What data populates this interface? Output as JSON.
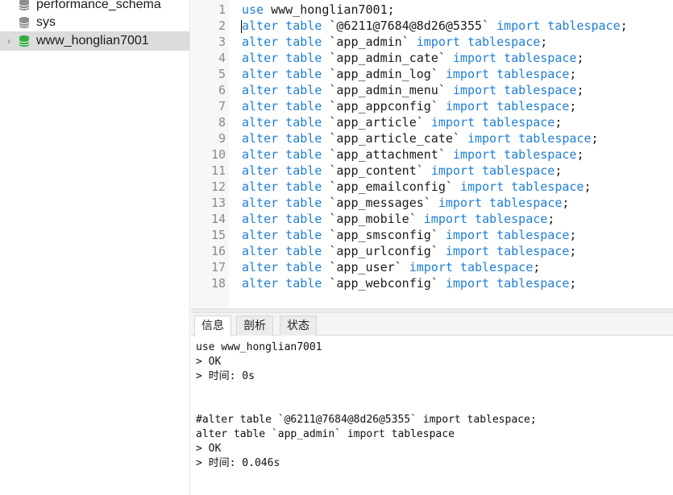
{
  "sidebar": {
    "databases": [
      {
        "name": "performance_schema",
        "selected": false
      },
      {
        "name": "sys",
        "selected": false
      },
      {
        "name": "www_honglian7001",
        "selected": true
      }
    ],
    "colors": {
      "db_gray": "#8c8c8c",
      "db_active": "#2eaa3c"
    }
  },
  "editor": {
    "lines": [
      {
        "num": "1",
        "kw": "use",
        "rest": " www_honglian7001;",
        "kw2": ""
      },
      {
        "num": "2",
        "kw": "alter table",
        "rest": " `@6211@7684@8d26@5355` ",
        "kw2": "import tablespace",
        "end": ";"
      },
      {
        "num": "3",
        "kw": "alter table",
        "rest": " `app_admin` ",
        "kw2": "import tablespace",
        "end": ";"
      },
      {
        "num": "4",
        "kw": "alter table",
        "rest": " `app_admin_cate` ",
        "kw2": "import tablespace",
        "end": ";"
      },
      {
        "num": "5",
        "kw": "alter table",
        "rest": " `app_admin_log` ",
        "kw2": "import tablespace",
        "end": ";"
      },
      {
        "num": "6",
        "kw": "alter table",
        "rest": " `app_admin_menu` ",
        "kw2": "import tablespace",
        "end": ";"
      },
      {
        "num": "7",
        "kw": "alter table",
        "rest": " `app_appconfig` ",
        "kw2": "import tablespace",
        "end": ";"
      },
      {
        "num": "8",
        "kw": "alter table",
        "rest": " `app_article` ",
        "kw2": "import tablespace",
        "end": ";"
      },
      {
        "num": "9",
        "kw": "alter table",
        "rest": " `app_article_cate` ",
        "kw2": "import tablespace",
        "end": ";"
      },
      {
        "num": "10",
        "kw": "alter table",
        "rest": " `app_attachment` ",
        "kw2": "import tablespace",
        "end": ";"
      },
      {
        "num": "11",
        "kw": "alter table",
        "rest": " `app_content` ",
        "kw2": "import tablespace",
        "end": ";"
      },
      {
        "num": "12",
        "kw": "alter table",
        "rest": " `app_emailconfig` ",
        "kw2": "import tablespace",
        "end": ";"
      },
      {
        "num": "13",
        "kw": "alter table",
        "rest": " `app_messages` ",
        "kw2": "import tablespace",
        "end": ";"
      },
      {
        "num": "14",
        "kw": "alter table",
        "rest": " `app_mobile` ",
        "kw2": "import tablespace",
        "end": ";"
      },
      {
        "num": "15",
        "kw": "alter table",
        "rest": " `app_smsconfig` ",
        "kw2": "import tablespace",
        "end": ";"
      },
      {
        "num": "16",
        "kw": "alter table",
        "rest": " `app_urlconfig` ",
        "kw2": "import tablespace",
        "end": ";"
      },
      {
        "num": "17",
        "kw": "alter table",
        "rest": " `app_user` ",
        "kw2": "import tablespace",
        "end": ";"
      },
      {
        "num": "18",
        "kw": "alter table",
        "rest": " `app_webconfig` ",
        "kw2": "import tablespace",
        "end": ";"
      }
    ],
    "colors": {
      "keyword": "#1f7ed6",
      "text": "#1a1a1a"
    }
  },
  "results": {
    "tabs": [
      {
        "label": "信息",
        "active": true
      },
      {
        "label": "剖析",
        "active": false
      },
      {
        "label": "状态",
        "active": false
      }
    ],
    "messages": [
      "use www_honglian7001",
      "> OK",
      "> 时间: 0s",
      "",
      "",
      "#alter table `@6211@7684@8d26@5355` import tablespace;",
      "alter table `app_admin` import tablespace",
      "> OK",
      "> 时间: 0.046s"
    ]
  }
}
